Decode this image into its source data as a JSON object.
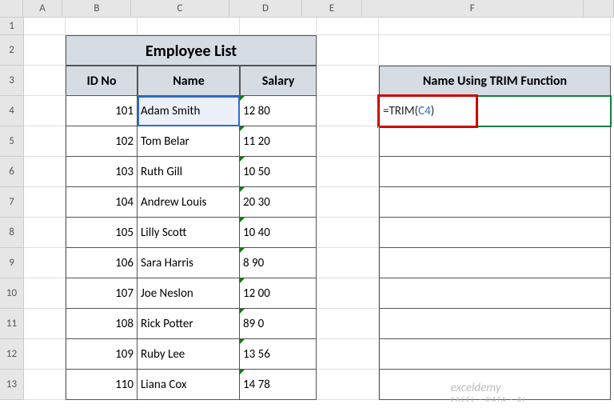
{
  "columns": [
    "A",
    "B",
    "C",
    "D",
    "E",
    "F"
  ],
  "rows": [
    "1",
    "2",
    "3",
    "4",
    "5",
    "6",
    "7",
    "8",
    "9",
    "10",
    "11",
    "12",
    "13"
  ],
  "title": "Employee List",
  "headers": {
    "b": "ID No",
    "c": "Name",
    "d": "Salary"
  },
  "rightHeader": "Name Using TRIM Function",
  "data": [
    {
      "id": "101",
      "name": " Adam  Smith",
      "salary": "12 80"
    },
    {
      "id": "102",
      "name": "Tom   Belar",
      "salary": "11 20"
    },
    {
      "id": "103",
      "name": "  Ruth Gill",
      "salary": "10 50"
    },
    {
      "id": "104",
      "name": "Andrew   Louis",
      "salary": "20 30"
    },
    {
      "id": "105",
      "name": " Lilly  Scott",
      "salary": "10 40"
    },
    {
      "id": "106",
      "name": "Sara   Harris",
      "salary": "8 90"
    },
    {
      "id": "107",
      "name": "Joe   Neslon",
      "salary": "12 00"
    },
    {
      "id": "108",
      "name": "  Rick  Potter",
      "salary": "89 0"
    },
    {
      "id": "109",
      "name": "Ruby  Lee",
      "salary": "13 56"
    },
    {
      "id": "110",
      "name": " Liana  Cox",
      "salary": "14 78"
    }
  ],
  "formula": {
    "prefix": "=TRIM(",
    "ref": "C4",
    "suffix": ")"
  },
  "watermark": {
    "main": "exceldemy",
    "sub": "EXCEL · DATA · BI"
  }
}
